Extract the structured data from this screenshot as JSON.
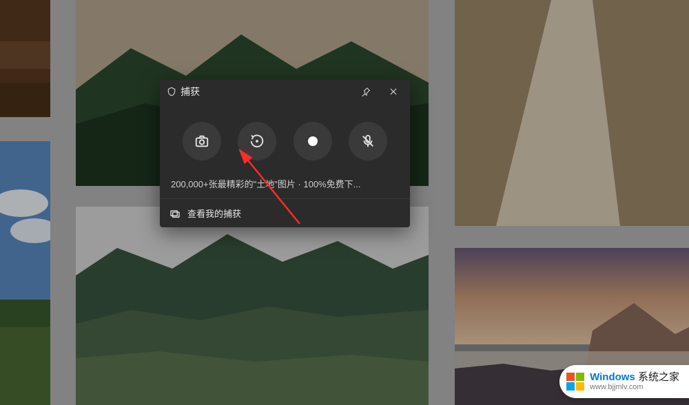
{
  "panel": {
    "title": "捕获",
    "description": "200,000+张最精彩的\"土地\"图片 · 100%免费下...",
    "footer_label": "查看我的捕获",
    "buttons": {
      "screenshot": "camera-icon",
      "capture_region": "refresh-icon",
      "record": "record-icon",
      "mic_disabled": "mic-off-icon"
    }
  },
  "watermark": {
    "brand": "Windows",
    "suffix": "系统之家",
    "url": "www.bjjmlv.com"
  },
  "colors": {
    "panel_bg": "#2b2b2b",
    "circle_bg": "#3a3a3a",
    "arrow": "#ff2b2b",
    "win_red": "#f25022",
    "win_green": "#7fba00",
    "win_blue": "#00a4ef",
    "win_yellow": "#ffb900"
  }
}
